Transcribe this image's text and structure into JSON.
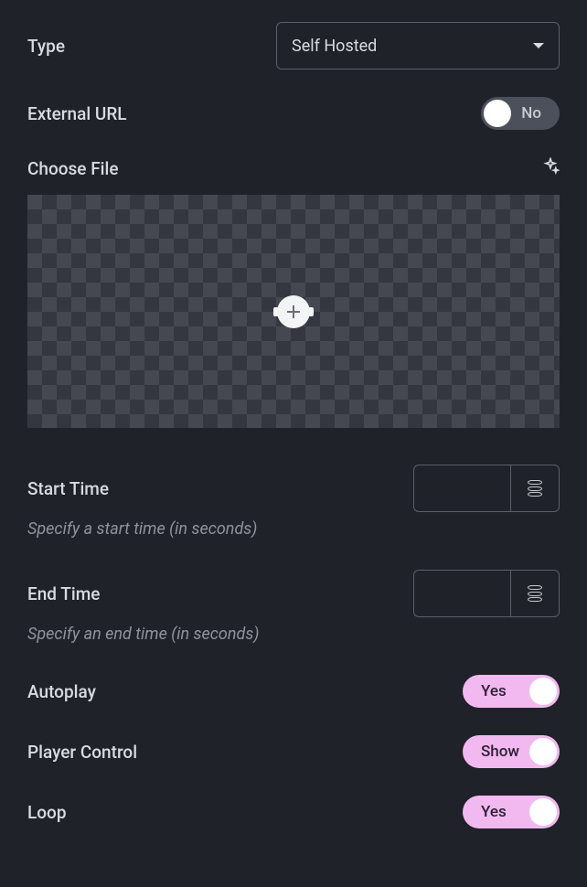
{
  "type": {
    "label": "Type",
    "value": "Self Hosted"
  },
  "external_url": {
    "label": "External URL",
    "toggle_text": "No",
    "on": false
  },
  "choose_file": {
    "label": "Choose File"
  },
  "start_time": {
    "label": "Start Time",
    "value": "",
    "hint": "Specify a start time (in seconds)"
  },
  "end_time": {
    "label": "End Time",
    "value": "",
    "hint": "Specify an end time (in seconds)"
  },
  "autoplay": {
    "label": "Autoplay",
    "toggle_text": "Yes",
    "on": true
  },
  "player_control": {
    "label": "Player Control",
    "toggle_text": "Show",
    "on": true
  },
  "loop": {
    "label": "Loop",
    "toggle_text": "Yes",
    "on": true
  }
}
